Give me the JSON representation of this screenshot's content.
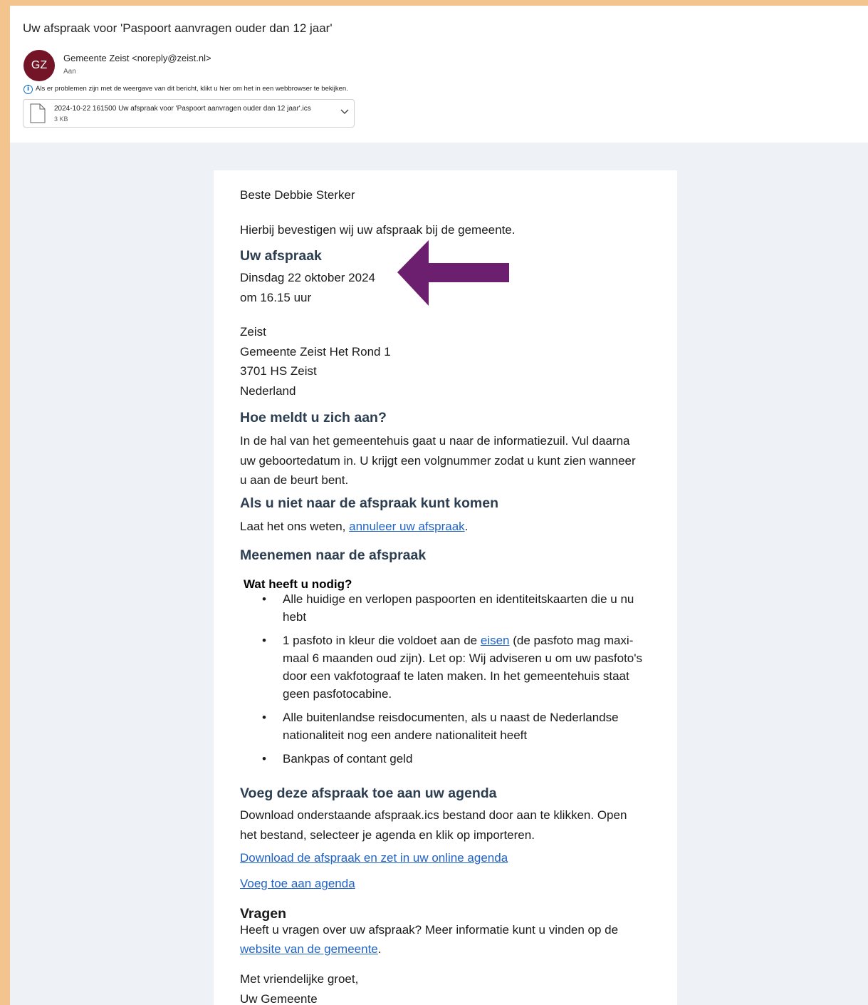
{
  "email": {
    "subject": "Uw afspraak voor 'Paspoort aanvragen ouder dan 12 jaar'",
    "avatar_initials": "GZ",
    "avatar_color": "#741427",
    "sender": "Gemeente Zeist <noreply@zeist.nl>",
    "to_label": "Aan",
    "info_text": "Als er problemen zijn met de weergave van dit bericht, klikt u hier om het in een webbrowser te bekijken.",
    "attachment": {
      "name": "2024-10-22 161500 Uw afspraak voor 'Paspoort aanvragen ouder dan 12 jaar'.ics",
      "size": "3 KB"
    }
  },
  "body": {
    "greeting": "Beste Debbie Sterker",
    "confirm": "Hierbij bevestigen wij uw afspraak bij de gemeente.",
    "appointment_heading": "Uw afspraak",
    "date": "Dinsdag 22 oktober 2024",
    "time": "om 16.15 uur",
    "address": [
      "Zeist",
      "Gemeente Zeist Het Rond 1",
      "3701 HS Zeist",
      "Nederland"
    ],
    "checkin_heading": "Hoe meldt u zich aan?",
    "checkin_lines": [
      "In de hal van het gemeentehuis gaat u naar de informatiezuil. Vul daarna",
      "uw geboortedatum in. U krijgt een volgnummer zodat u kunt zien wanneer",
      "u aan de beurt bent."
    ],
    "cancel_heading": "Als u niet naar de afspraak kunt komen",
    "cancel_prefix": "Laat het ons weten, ",
    "cancel_link": "annuleer uw afspraak",
    "cancel_suffix": ".",
    "bring_heading": "Meenemen naar de afspraak",
    "need_heading": "Wat heeft u nodig?",
    "items": {
      "item1": "Alle huidige en verlopen paspoorten en identiteitskaarten die u nu hebt",
      "item2_prefix": "1 pasfoto in kleur die voldoet aan de ",
      "item2_link": "eisen",
      "item2_suffix": " (de pasfoto mag maxi-maal 6 maanden oud zijn). Let op: Wij adviseren u om uw pasfoto's door een vakfotograaf te laten maken. In het gemeentehuis staat geen pasfotocabine.",
      "item3": "Alle buitenlandse reisdocumenten, als u naast de Nederlandse nationaliteit nog een andere nationaliteit heeft",
      "item4": "Bankpas of contant geld"
    },
    "agenda_heading": "Voeg deze afspraak toe aan uw agenda",
    "agenda_lines": [
      "Download onderstaande afspraak.ics bestand door aan te klikken. Open",
      "het bestand, selecteer je agenda en klik op importeren."
    ],
    "download_link": "Download de afspraak en zet in uw online agenda",
    "add_link": "Voeg toe aan agenda",
    "questions_heading": "Vragen",
    "questions_text": "Heeft u vragen over uw afspraak? Meer informatie kunt u vinden op de",
    "website_link": "website van de gemeente",
    "website_suffix": ".",
    "closing": "Met vriendelijke groet,",
    "signature": "Uw Gemeente"
  },
  "colors": {
    "frame": "#f4c48e",
    "arrow": "#6b1f6e",
    "link": "#1f63c6",
    "heading": "#2c3e50"
  }
}
